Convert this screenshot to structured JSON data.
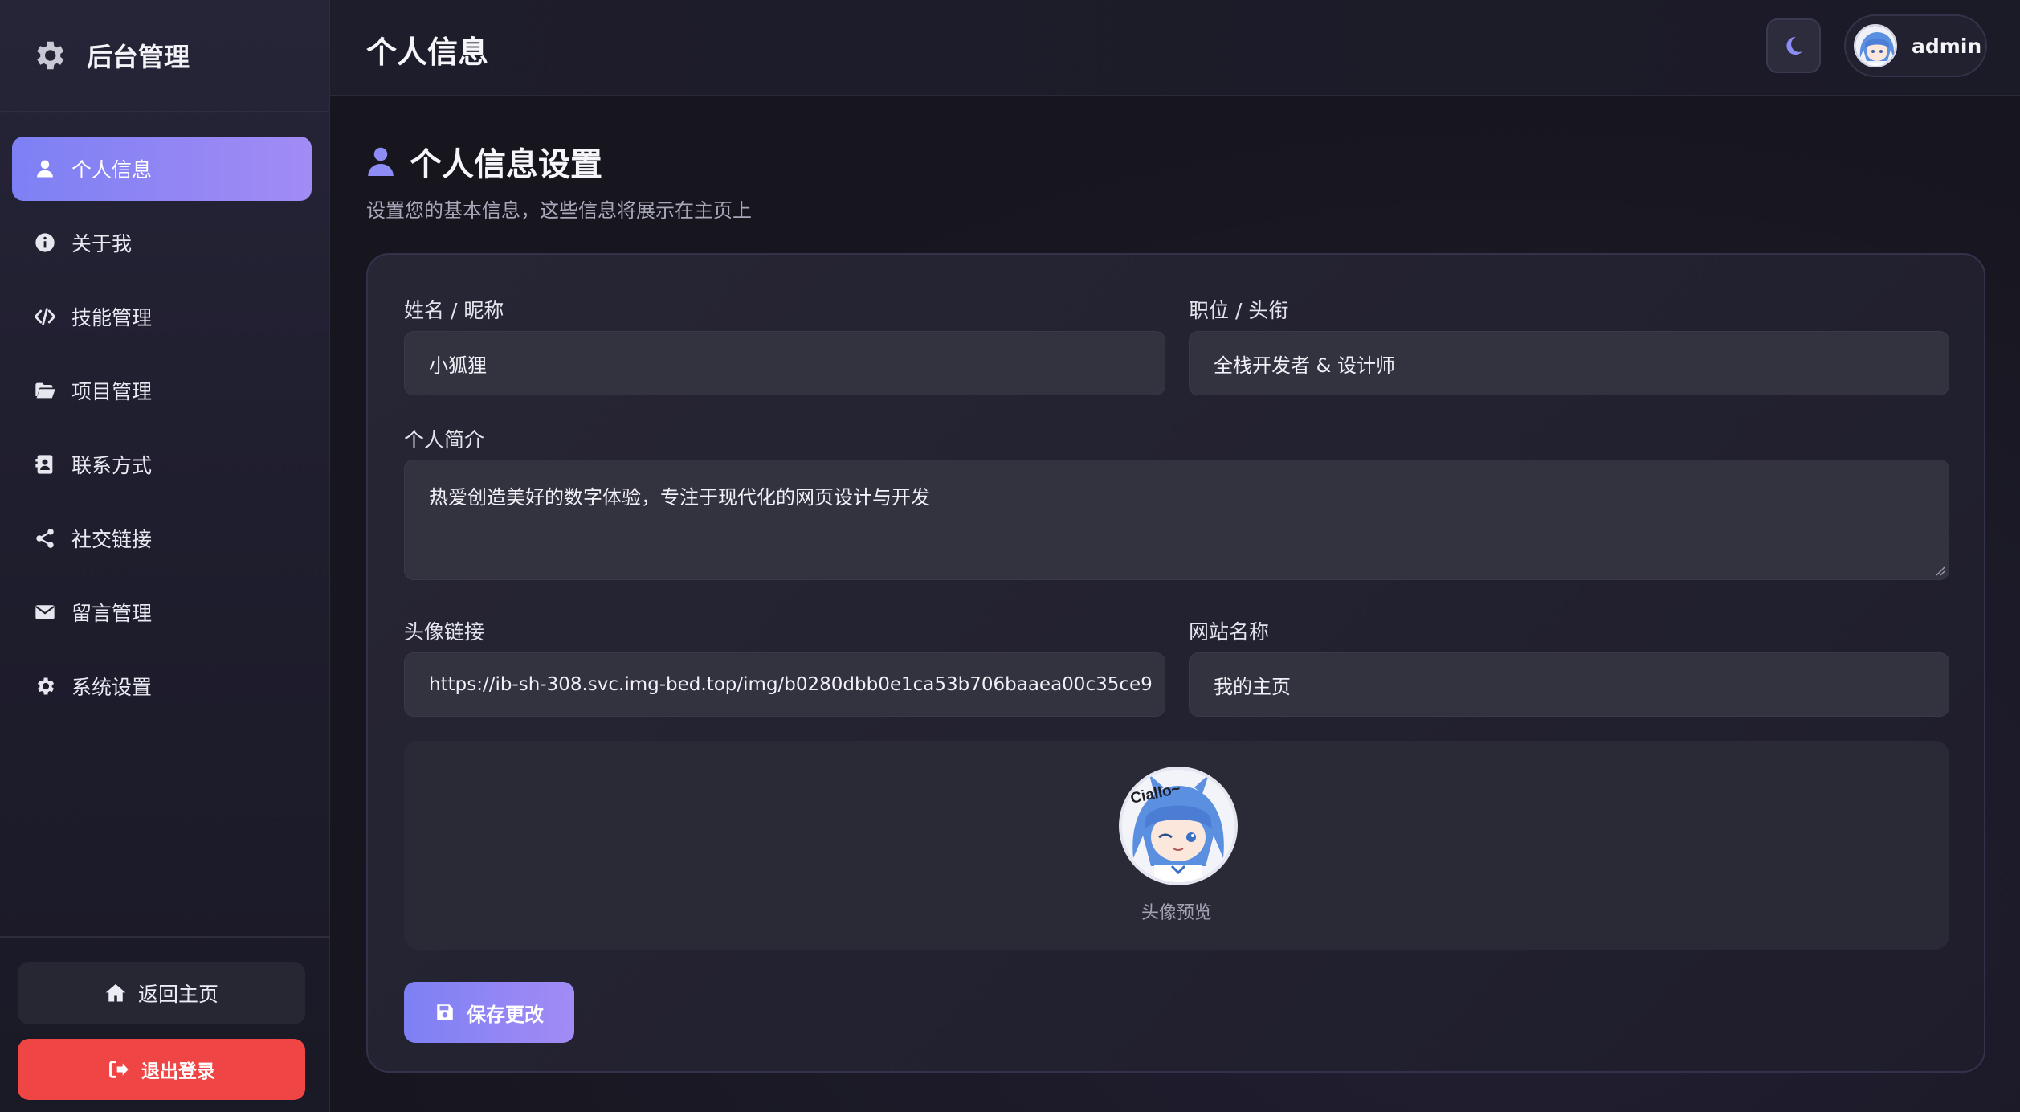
{
  "sidebar": {
    "brand_title": "后台管理",
    "brand_icon": "gear-icon",
    "items": [
      {
        "label": "个人信息",
        "icon": "user-icon",
        "active": true
      },
      {
        "label": "关于我",
        "icon": "info-circle-icon"
      },
      {
        "label": "技能管理",
        "icon": "code-icon"
      },
      {
        "label": "项目管理",
        "icon": "folder-open-icon"
      },
      {
        "label": "联系方式",
        "icon": "address-card-icon"
      },
      {
        "label": "社交链接",
        "icon": "share-nodes-icon"
      },
      {
        "label": "留言管理",
        "icon": "envelope-icon"
      },
      {
        "label": "系统设置",
        "icon": "gear-icon"
      }
    ],
    "home_label": "返回主页",
    "logout_label": "退出登录"
  },
  "header": {
    "title": "个人信息",
    "theme_icon": "moon-icon",
    "username": "admin"
  },
  "main": {
    "section_title": "个人信息设置",
    "section_subtitle": "设置您的基本信息，这些信息将展示在主页上",
    "form": {
      "name_label": "姓名 / 昵称",
      "name_value": "小狐狸",
      "title_label": "职位 / 头衔",
      "title_value": "全栈开发者 & 设计师",
      "bio_label": "个人简介",
      "bio_value": "热爱创造美好的数字体验，专注于现代化的网页设计与开发",
      "avatar_label": "头像链接",
      "avatar_value": "https://ib-sh-308.svc.img-bed.top/img/b0280dbb0e1ca53b706baaea00c35ce9",
      "site_label": "网站名称",
      "site_value": "我的主页"
    },
    "preview_caption": "头像预览",
    "avatar_text": "Ciallo~",
    "save_label": "保存更改"
  },
  "colors": {
    "accent_start": "#7d80f4",
    "accent_end": "#a28bf4",
    "danger": "#f04545",
    "background": "#16151f"
  }
}
